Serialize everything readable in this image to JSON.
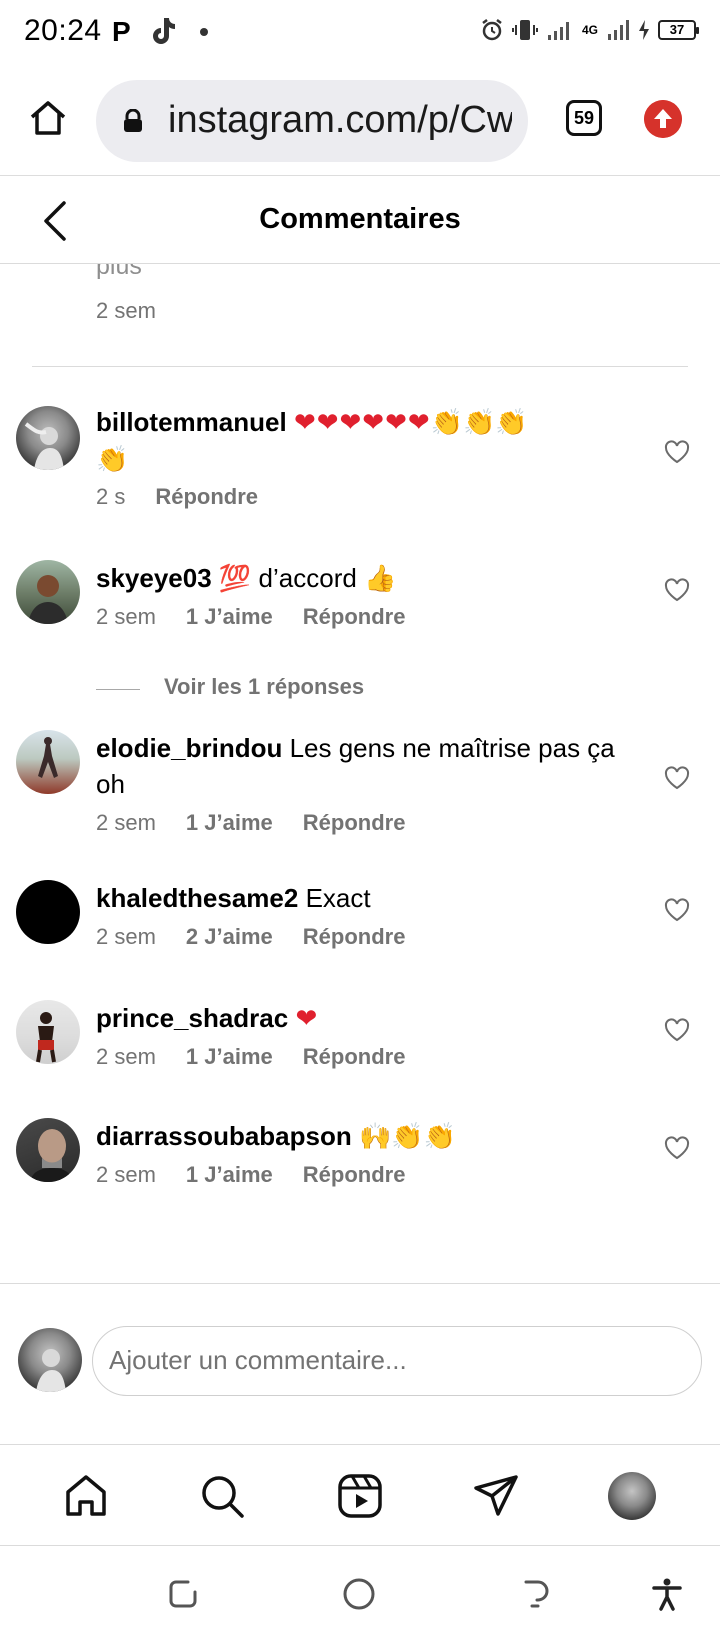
{
  "status_bar": {
    "time": "20:24",
    "notif_p": "P",
    "network": "4G",
    "battery": "37"
  },
  "browser": {
    "url": "instagram.com/p/Cw",
    "tab_count": "59"
  },
  "header": {
    "title": "Commentaires"
  },
  "previous_comment": {
    "text": "plus",
    "time": "2 sem"
  },
  "comments": [
    {
      "username": "billotemmanuel",
      "text": "",
      "emoji_text": "❤❤❤❤❤❤👏👏👏👏",
      "time": "2 s",
      "likes": "",
      "reply_label": "Répondre"
    },
    {
      "username": "skyeye03",
      "text": "d’accord",
      "emoji_prefix": "💯",
      "emoji_suffix": "👍",
      "time": "2 sem",
      "likes": "1 J’aime",
      "reply_label": "Répondre"
    },
    {
      "username": "elodie_brindou",
      "text": "Les gens ne maîtrise pas ça oh",
      "time": "2 sem",
      "likes": "1 J’aime",
      "reply_label": "Répondre"
    },
    {
      "username": "khaledthesame2",
      "text": "Exact",
      "time": "2 sem",
      "likes": "2 J’aime",
      "reply_label": "Répondre"
    },
    {
      "username": "prince_shadrac",
      "text": "",
      "emoji_text": "❤",
      "time": "2 sem",
      "likes": "1 J’aime",
      "reply_label": "Répondre"
    },
    {
      "username": "diarrassoubabapson",
      "text": "",
      "emoji_text": "🙌👏👏",
      "time": "2 sem",
      "likes": "1 J’aime",
      "reply_label": "Répondre"
    }
  ],
  "view_replies": "Voir les 1 réponses",
  "composer": {
    "placeholder": "Ajouter un commentaire..."
  },
  "colors": {
    "meta_gray": "#737373",
    "divider": "#dbdbdb",
    "update_red": "#d6322b",
    "url_bg": "#ececf0"
  },
  "icons": {
    "heart": "heart-outline-icon",
    "home": "home-icon",
    "search": "search-icon",
    "reels": "reels-icon",
    "direct": "paper-plane-icon"
  }
}
